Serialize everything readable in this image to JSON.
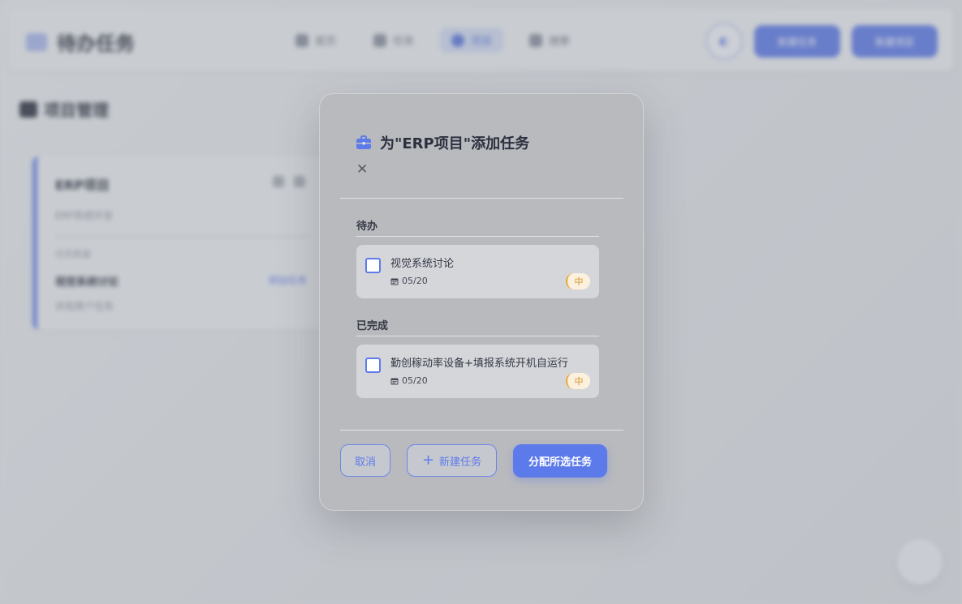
{
  "background": {
    "app_title": "待办任务",
    "nav": [
      "首页",
      "任务",
      "项目",
      "搜索"
    ],
    "top_buttons": [
      "新建任务",
      "新建项目"
    ],
    "section_title": "项目管理",
    "project_card": {
      "title": "ERP项目",
      "description": "ERP系统开发",
      "meta": "任务数量",
      "task_title": "视觉系统讨论",
      "link": "添加任务",
      "sub": "共有两个任务"
    }
  },
  "modal": {
    "title": "为\"ERP项目\"添加任务",
    "groups": [
      {
        "label": "待办",
        "tasks": [
          {
            "title": "视觉系统讨论",
            "date": "05/20",
            "priority": "中"
          }
        ]
      },
      {
        "label": "已完成",
        "tasks": [
          {
            "title": "勤创稼动率设备+填报系统开机自运行",
            "date": "05/20",
            "priority": "中"
          }
        ]
      }
    ],
    "buttons": {
      "cancel": "取消",
      "new_task": "新建任务",
      "assign": "分配所选任务"
    }
  },
  "colors": {
    "accent": "#5d7aeb",
    "priority_medium": "#e9a530"
  },
  "icons": [
    "briefcase-icon",
    "close-icon",
    "calendar-icon",
    "plus-icon"
  ]
}
